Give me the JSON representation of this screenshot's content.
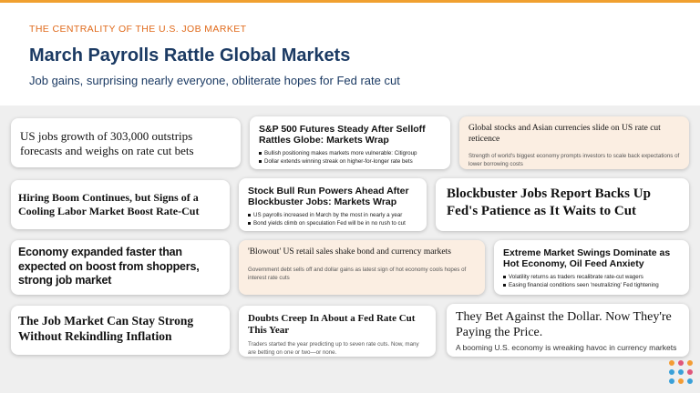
{
  "header": {
    "eyebrow": "THE CENTRALITY OF THE U.S. JOB MARKET",
    "title": "March Payrolls Rattle Global Markets",
    "subtitle": "Job gains, surprising nearly everyone, obliterate hopes for Fed rate cut"
  },
  "cards": [
    {
      "headline": "US jobs growth of 303,000 outstrips forecasts and weighs on rate cut bets"
    },
    {
      "headline": "S&P 500 Futures Steady After Selloff Rattles Globe: Markets Wrap",
      "bullets": [
        "Bullish positioning makes markets more vulnerable: Citigroup",
        "Dollar extends winning streak on higher-for-longer rate bets"
      ]
    },
    {
      "headline": "Global stocks and Asian currencies slide on US rate cut reticence",
      "dek": "Strength of world's biggest economy prompts investors to scale back expectations of lower borrowing costs"
    },
    {
      "headline": "Hiring Boom Continues, but Signs of a Cooling Labor Market Boost Rate-Cut"
    },
    {
      "headline": "Stock Bull Run Powers Ahead After Blockbuster Jobs: Markets Wrap",
      "bullets": [
        "US payrolls increased in March by the most in nearly a year",
        "Bond yields climb on speculation Fed will be in no rush to cut"
      ]
    },
    {
      "headline": "Blockbuster Jobs Report Backs Up Fed's Patience as It Waits to Cut"
    },
    {
      "headline": "Economy expanded faster than expected on boost from shoppers, strong job market"
    },
    {
      "headline": "'Blowout' US retail sales shake bond and currency markets",
      "dek": "Government debt sells off and dollar gains as latest sign of hot economy cools hopes of interest rate cuts"
    },
    {
      "headline": "Extreme Market Swings Dominate as Hot Economy, Oil Feed Anxiety",
      "bullets": [
        "Volatility returns as traders recalibrate rate-cut wagers",
        "Easing financial conditions seen 'neutralizing' Fed tightening"
      ]
    },
    {
      "headline": "The Job Market Can Stay Strong Without Rekindling Inflation"
    },
    {
      "headline": "Doubts Creep In About a Fed Rate Cut This Year",
      "dek": "Traders started the year predicting up to seven rate cuts. Now, many are betting on one or two—or none."
    },
    {
      "headline": "They Bet Against the Dollar. Now They're Paying the Price.",
      "dek": "A booming U.S. economy is wreaking havoc in currency markets"
    }
  ],
  "colors": {
    "accent": "#e06a1b",
    "title": "#1b3a63",
    "peach_card": "#fbeee2",
    "background": "#efefef"
  },
  "logo": {
    "icon": "dot-grid-logo-icon"
  }
}
